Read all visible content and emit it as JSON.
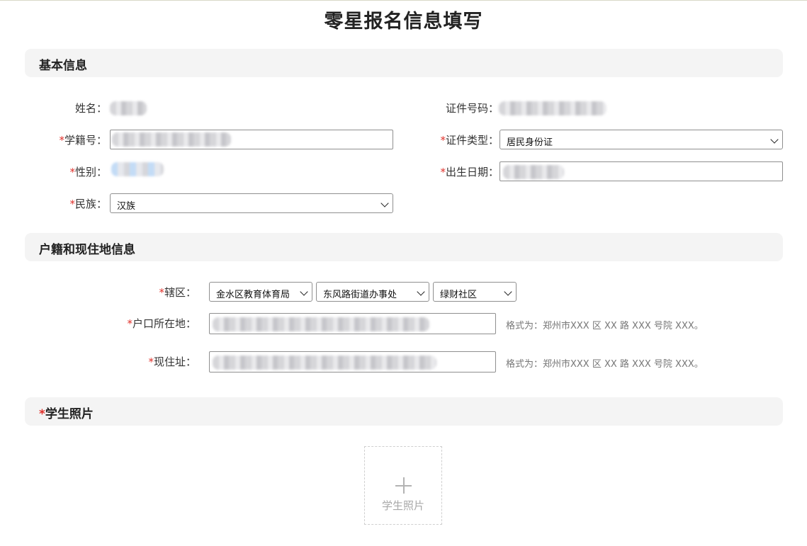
{
  "page": {
    "title": "零星报名信息填写"
  },
  "basic": {
    "section_title": "基本信息",
    "name_label": "姓名：",
    "id_number_label": "证件号码：",
    "student_no_label": "学籍号：",
    "id_type_label": "证件类型：",
    "id_type_value": "居民身份证",
    "gender_label": "性别：",
    "birth_label": "出生日期：",
    "ethnicity_label": "民族：",
    "ethnicity_value": "汉族"
  },
  "residence": {
    "section_title": "户籍和现住地信息",
    "district_label": "辖区：",
    "district_1": "金水区教育体育局",
    "district_2": "东风路街道办事处",
    "district_3": "绿财社区",
    "hukou_label": "户口所在地：",
    "hukou_hint": "格式为：郑州市XXX 区 XX 路 XXX 号院 XXX。",
    "current_label": "现住址：",
    "current_hint": "格式为：郑州市XXX 区 XX 路 XXX 号院 XXX。"
  },
  "photo": {
    "section_title": "学生照片",
    "upload_label": "学生照片",
    "plus_symbol": "+"
  },
  "required_mark": "*",
  "colors": {
    "required": "#e0312b",
    "section_bg": "#f4f4f4",
    "hint": "#777777"
  },
  "icons": {
    "select_arrow": "chevron-down-icon",
    "upload": "plus-icon"
  }
}
